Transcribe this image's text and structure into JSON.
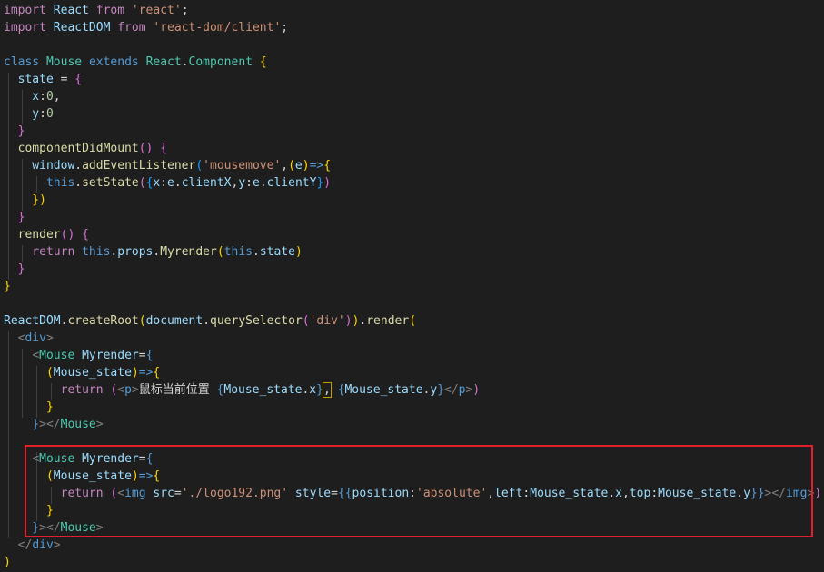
{
  "editor": {
    "language": "javascript-react",
    "colors": {
      "background": "#1e1e1e",
      "highlight_border": "#e0202a"
    },
    "lines": [
      [
        {
          "t": "import",
          "c": "imp"
        },
        {
          "t": " React ",
          "c": "id"
        },
        {
          "t": "from",
          "c": "imp"
        },
        {
          "t": " ",
          "c": "txt"
        },
        {
          "t": "'react'",
          "c": "str"
        },
        {
          "t": ";",
          "c": "txt"
        }
      ],
      [
        {
          "t": "import",
          "c": "imp"
        },
        {
          "t": " ReactDOM ",
          "c": "id"
        },
        {
          "t": "from",
          "c": "imp"
        },
        {
          "t": " ",
          "c": "txt"
        },
        {
          "t": "'react-dom/client'",
          "c": "str"
        },
        {
          "t": ";",
          "c": "txt"
        }
      ],
      [],
      [
        {
          "t": "class",
          "c": "kw"
        },
        {
          "t": " ",
          "c": "txt"
        },
        {
          "t": "Mouse",
          "c": "cls"
        },
        {
          "t": " ",
          "c": "txt"
        },
        {
          "t": "extends",
          "c": "kw"
        },
        {
          "t": " ",
          "c": "txt"
        },
        {
          "t": "React",
          "c": "cls"
        },
        {
          "t": ".",
          "c": "txt"
        },
        {
          "t": "Component",
          "c": "cls"
        },
        {
          "t": " ",
          "c": "txt"
        },
        {
          "t": "{",
          "c": "y"
        }
      ],
      [
        {
          "t": "  state",
          "c": "id"
        },
        {
          "t": " = ",
          "c": "txt"
        },
        {
          "t": "{",
          "c": "p"
        }
      ],
      [
        {
          "t": "    x",
          "c": "id"
        },
        {
          "t": ":",
          "c": "txt"
        },
        {
          "t": "0",
          "c": "num"
        },
        {
          "t": ",",
          "c": "txt"
        }
      ],
      [
        {
          "t": "    y",
          "c": "id"
        },
        {
          "t": ":",
          "c": "txt"
        },
        {
          "t": "0",
          "c": "num"
        }
      ],
      [
        {
          "t": "  }",
          "c": "p"
        }
      ],
      [
        {
          "t": "  componentDidMount",
          "c": "fn"
        },
        {
          "t": "() ",
          "c": "p"
        },
        {
          "t": "{",
          "c": "p"
        }
      ],
      [
        {
          "t": "    window",
          "c": "id"
        },
        {
          "t": ".",
          "c": "txt"
        },
        {
          "t": "addEventListener",
          "c": "fn"
        },
        {
          "t": "(",
          "c": "b"
        },
        {
          "t": "'mousemove'",
          "c": "str"
        },
        {
          "t": ",",
          "c": "txt"
        },
        {
          "t": "(",
          "c": "y"
        },
        {
          "t": "e",
          "c": "id"
        },
        {
          "t": ")",
          "c": "y"
        },
        {
          "t": "=>",
          "c": "kw"
        },
        {
          "t": "{",
          "c": "y"
        }
      ],
      [
        {
          "t": "      this",
          "c": "kw"
        },
        {
          "t": ".",
          "c": "txt"
        },
        {
          "t": "setState",
          "c": "fn"
        },
        {
          "t": "(",
          "c": "p"
        },
        {
          "t": "{",
          "c": "b"
        },
        {
          "t": "x",
          "c": "id"
        },
        {
          "t": ":",
          "c": "txt"
        },
        {
          "t": "e",
          "c": "id"
        },
        {
          "t": ".",
          "c": "txt"
        },
        {
          "t": "clientX",
          "c": "id"
        },
        {
          "t": ",",
          "c": "txt"
        },
        {
          "t": "y",
          "c": "id"
        },
        {
          "t": ":",
          "c": "txt"
        },
        {
          "t": "e",
          "c": "id"
        },
        {
          "t": ".",
          "c": "txt"
        },
        {
          "t": "clientY",
          "c": "id"
        },
        {
          "t": "}",
          "c": "b"
        },
        {
          "t": ")",
          "c": "p"
        }
      ],
      [
        {
          "t": "    })",
          "c": "y"
        }
      ],
      [
        {
          "t": "  }",
          "c": "p"
        }
      ],
      [
        {
          "t": "  render",
          "c": "fn"
        },
        {
          "t": "() ",
          "c": "p"
        },
        {
          "t": "{",
          "c": "p"
        }
      ],
      [
        {
          "t": "    return",
          "c": "imp"
        },
        {
          "t": " ",
          "c": "txt"
        },
        {
          "t": "this",
          "c": "kw"
        },
        {
          "t": ".",
          "c": "txt"
        },
        {
          "t": "props",
          "c": "id"
        },
        {
          "t": ".",
          "c": "txt"
        },
        {
          "t": "Myrender",
          "c": "fn"
        },
        {
          "t": "(",
          "c": "y"
        },
        {
          "t": "this",
          "c": "kw"
        },
        {
          "t": ".",
          "c": "txt"
        },
        {
          "t": "state",
          "c": "id"
        },
        {
          "t": ")",
          "c": "y"
        }
      ],
      [
        {
          "t": "  }",
          "c": "p"
        }
      ],
      [
        {
          "t": "}",
          "c": "y"
        }
      ],
      [],
      [
        {
          "t": "ReactDOM",
          "c": "id"
        },
        {
          "t": ".",
          "c": "txt"
        },
        {
          "t": "createRoot",
          "c": "fn"
        },
        {
          "t": "(",
          "c": "y"
        },
        {
          "t": "document",
          "c": "id"
        },
        {
          "t": ".",
          "c": "txt"
        },
        {
          "t": "querySelector",
          "c": "fn"
        },
        {
          "t": "(",
          "c": "p"
        },
        {
          "t": "'div'",
          "c": "str"
        },
        {
          "t": ")",
          "c": "p"
        },
        {
          "t": ")",
          "c": "y"
        },
        {
          "t": ".",
          "c": "txt"
        },
        {
          "t": "render",
          "c": "fn"
        },
        {
          "t": "(",
          "c": "y"
        }
      ],
      [
        {
          "t": "  ",
          "c": "txt"
        },
        {
          "t": "<",
          "c": "tag"
        },
        {
          "t": "div",
          "c": "kw"
        },
        {
          "t": ">",
          "c": "tag"
        }
      ],
      [
        {
          "t": "    ",
          "c": "txt"
        },
        {
          "t": "<",
          "c": "tag"
        },
        {
          "t": "Mouse",
          "c": "cls"
        },
        {
          "t": " ",
          "c": "txt"
        },
        {
          "t": "Myrender",
          "c": "id"
        },
        {
          "t": "=",
          "c": "txt"
        },
        {
          "t": "{",
          "c": "kw"
        }
      ],
      [
        {
          "t": "      ",
          "c": "txt"
        },
        {
          "t": "(",
          "c": "y"
        },
        {
          "t": "Mouse_state",
          "c": "id"
        },
        {
          "t": ")",
          "c": "y"
        },
        {
          "t": "=>",
          "c": "kw"
        },
        {
          "t": "{",
          "c": "y"
        }
      ],
      [
        {
          "t": "        return",
          "c": "imp"
        },
        {
          "t": " ",
          "c": "txt"
        },
        {
          "t": "(",
          "c": "p"
        },
        {
          "t": "<",
          "c": "tag"
        },
        {
          "t": "p",
          "c": "kw"
        },
        {
          "t": ">",
          "c": "tag"
        },
        {
          "t": "鼠标当前位置 ",
          "c": "txt"
        },
        {
          "t": "{",
          "c": "kw"
        },
        {
          "t": "Mouse_state",
          "c": "id"
        },
        {
          "t": ".",
          "c": "txt"
        },
        {
          "t": "x",
          "c": "id"
        },
        {
          "t": "}",
          "c": "kw"
        },
        {
          "t": ",",
          "c": "txt",
          "box": true
        },
        {
          "t": " ",
          "c": "txt"
        },
        {
          "t": "{",
          "c": "kw"
        },
        {
          "t": "Mouse_state",
          "c": "id"
        },
        {
          "t": ".",
          "c": "txt"
        },
        {
          "t": "y",
          "c": "id"
        },
        {
          "t": "}",
          "c": "kw"
        },
        {
          "t": "</",
          "c": "tag"
        },
        {
          "t": "p",
          "c": "kw"
        },
        {
          "t": ">",
          "c": "tag"
        },
        {
          "t": ")",
          "c": "p"
        }
      ],
      [
        {
          "t": "      }",
          "c": "y"
        }
      ],
      [
        {
          "t": "    }",
          "c": "kw"
        },
        {
          "t": "></",
          "c": "tag"
        },
        {
          "t": "Mouse",
          "c": "cls"
        },
        {
          "t": ">",
          "c": "tag"
        }
      ],
      [],
      [
        {
          "t": "    ",
          "c": "txt"
        },
        {
          "t": "<",
          "c": "tag"
        },
        {
          "t": "Mouse",
          "c": "cls"
        },
        {
          "t": " ",
          "c": "txt"
        },
        {
          "t": "Myrender",
          "c": "id"
        },
        {
          "t": "=",
          "c": "txt"
        },
        {
          "t": "{",
          "c": "kw"
        }
      ],
      [
        {
          "t": "      ",
          "c": "txt"
        },
        {
          "t": "(",
          "c": "y"
        },
        {
          "t": "Mouse_state",
          "c": "id"
        },
        {
          "t": ")",
          "c": "y"
        },
        {
          "t": "=>",
          "c": "kw"
        },
        {
          "t": "{",
          "c": "y"
        }
      ],
      [
        {
          "t": "        return",
          "c": "imp"
        },
        {
          "t": " ",
          "c": "txt"
        },
        {
          "t": "(",
          "c": "p"
        },
        {
          "t": "<",
          "c": "tag"
        },
        {
          "t": "img",
          "c": "kw"
        },
        {
          "t": " ",
          "c": "txt"
        },
        {
          "t": "src",
          "c": "id"
        },
        {
          "t": "=",
          "c": "txt"
        },
        {
          "t": "'./logo192.png'",
          "c": "str"
        },
        {
          "t": " ",
          "c": "txt"
        },
        {
          "t": "style",
          "c": "id"
        },
        {
          "t": "=",
          "c": "txt"
        },
        {
          "t": "{{",
          "c": "kw"
        },
        {
          "t": "position",
          "c": "id"
        },
        {
          "t": ":",
          "c": "txt"
        },
        {
          "t": "'absolute'",
          "c": "str"
        },
        {
          "t": ",",
          "c": "txt"
        },
        {
          "t": "left",
          "c": "id"
        },
        {
          "t": ":",
          "c": "txt"
        },
        {
          "t": "Mouse_state",
          "c": "id"
        },
        {
          "t": ".",
          "c": "txt"
        },
        {
          "t": "x",
          "c": "id"
        },
        {
          "t": ",",
          "c": "txt"
        },
        {
          "t": "top",
          "c": "id"
        },
        {
          "t": ":",
          "c": "txt"
        },
        {
          "t": "Mouse_state",
          "c": "id"
        },
        {
          "t": ".",
          "c": "txt"
        },
        {
          "t": "y",
          "c": "id"
        },
        {
          "t": "}}",
          "c": "kw"
        },
        {
          "t": "></",
          "c": "tag"
        },
        {
          "t": "img",
          "c": "kw"
        },
        {
          "t": ">",
          "c": "tag"
        },
        {
          "t": ")",
          "c": "p"
        }
      ],
      [
        {
          "t": "      }",
          "c": "y"
        }
      ],
      [
        {
          "t": "    }",
          "c": "kw"
        },
        {
          "t": "></",
          "c": "tag"
        },
        {
          "t": "Mouse",
          "c": "cls"
        },
        {
          "t": ">",
          "c": "tag"
        }
      ],
      [
        {
          "t": "  ",
          "c": "txt"
        },
        {
          "t": "</",
          "c": "tag"
        },
        {
          "t": "div",
          "c": "kw"
        },
        {
          "t": ">",
          "c": "tag"
        }
      ],
      [
        {
          "t": ")",
          "c": "y"
        }
      ]
    ]
  }
}
